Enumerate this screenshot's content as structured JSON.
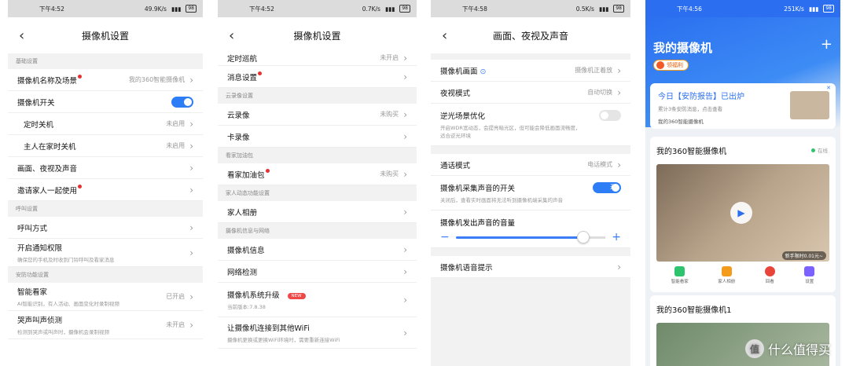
{
  "p1": {
    "status": {
      "time": "下午4:52",
      "speed": "49.9K/s",
      "battery": "98"
    },
    "title": "摄像机设置",
    "sec_basic": "基础设置",
    "name_label": "摄像机名称及场景",
    "name_val": "我的360智能摄像机",
    "switch_label": "摄像机开关",
    "timer_off": "定时关机",
    "timer_off_val": "未启用",
    "home_off": "主人在家时关机",
    "home_off_val": "未启用",
    "picture": "画面、夜视及声音",
    "invite": "邀请家人一起使用",
    "sec_call": "呼叫设置",
    "call_mode": "呼叫方式",
    "notify": "开启通知权限",
    "notify_sub": "确保您的手机及时收到门铃呼叫及看家消息",
    "sec_security": "安防功能设置",
    "smart": "智能看家",
    "smart_sub": "AI智能识别，有人活动、画面变化时录制视频",
    "smart_val": "已开启",
    "cry": "哭声叫声侦测",
    "cry_sub": "检测到哭声或叫声时，摄像机会录制视频",
    "cry_val": "未开启"
  },
  "p2": {
    "status": {
      "time": "下午4:52",
      "speed": "0.7K/s",
      "battery": "98"
    },
    "title": "摄像机设置",
    "patrol": "定时巡航",
    "patrol_val": "未开启",
    "msg": "消息设置",
    "sec_cloud": "云录像设置",
    "cloud": "云录像",
    "cloud_val": "未购买",
    "card": "卡录像",
    "sec_fuel": "看家加油包",
    "fuel": "看家加油包",
    "fuel_val": "未购买",
    "sec_family": "家人动态功能设置",
    "album": "家人相册",
    "sec_info": "摄像机信息与网络",
    "info": "摄像机信息",
    "net": "网络检测",
    "upgrade": "摄像机系统升级",
    "upgrade_sub": "当前版本:7.8.38",
    "new_badge": "NEW",
    "wifi": "让摄像机连接到其他WiFi",
    "wifi_sub": "摄像机更换或更换WiFi环境时，需要重新连接WiFi"
  },
  "p3": {
    "status": {
      "time": "下午4:58",
      "speed": "0.5K/s",
      "battery": "98"
    },
    "title": "画面、夜视及声音",
    "picture": "摄像机画面",
    "picture_val": "摄像机正着放",
    "night": "夜视模式",
    "night_val": "自动切换",
    "wdr": "逆光场景优化",
    "wdr_sub": "开启WDR宽动态，会提亮暗光区，但可能会降低画面流畅度，适合逆光环境",
    "call": "通话模式",
    "call_val": "电话模式",
    "mic": "摄像机采集声音的开关",
    "mic_sub": "关闭后，查看实时画面将无法听到摄像机端采集的声音",
    "mic_on": "开",
    "volume": "摄像机发出声音的音量",
    "volume_level": 0.85,
    "voice": "摄像机语音提示"
  },
  "p4": {
    "status": {
      "time": "下午4:56",
      "speed": "251K/s",
      "battery": "98"
    },
    "title": "我的摄像机",
    "bonus": "领福利",
    "report_title": "今日【安防报告】已出炉",
    "report_sub": "累计3条安防消息，点击查看",
    "report_cam": "我的360智能摄像机",
    "cam1": "我的360智能摄像机",
    "online": "在线",
    "promo": "新手限时0.01元~",
    "act1": "智能看家",
    "act2": "家人相册",
    "act3": "回看",
    "act4": "设置",
    "cam2": "我的360智能摄像机1",
    "watermark": "什么值得买",
    "watermark_icon": "值",
    "colors": {
      "blue": "#2b6ff0",
      "green": "#2ec46d",
      "orange": "#f39b1a",
      "red": "#e8443a",
      "purple": "#7b61ff"
    }
  }
}
